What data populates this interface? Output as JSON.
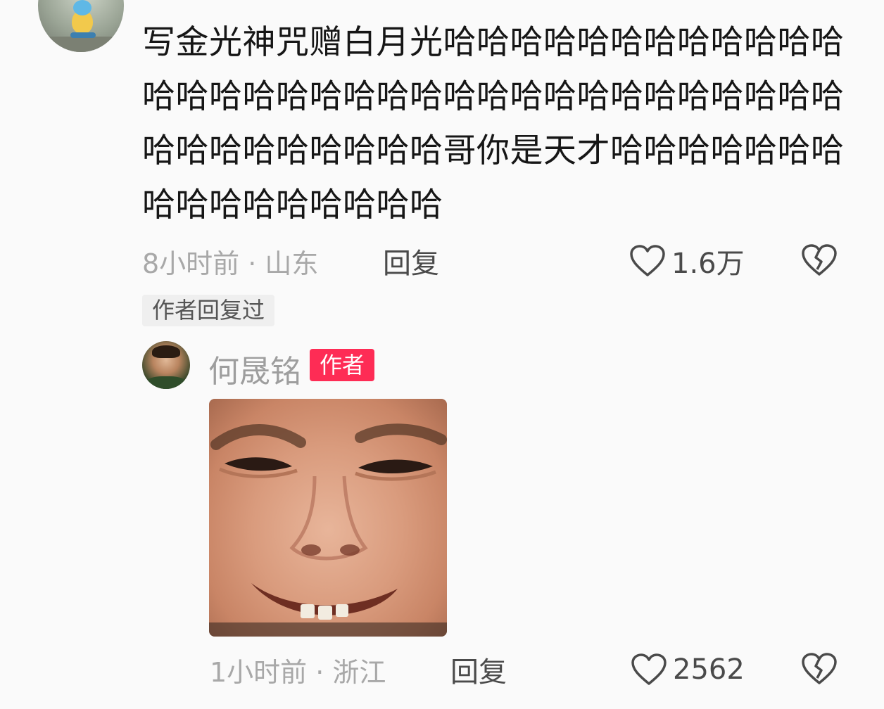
{
  "comment": {
    "text": "写金光神咒赠白月光哈哈哈哈哈哈哈哈哈哈哈哈哈哈哈哈哈哈哈哈哈哈哈哈哈哈哈哈哈哈哈哈哈哈哈哈哈哈哈哈哈哈哥你是天才哈哈哈哈哈哈哈哈哈哈哈哈哈哈哈哈",
    "time_location": "8小时前 · 山东",
    "reply_label": "回复",
    "like_count": "1.6万",
    "author_replied_tag": "作者回复过"
  },
  "reply": {
    "author_name": "何晟铭",
    "author_badge": "作者",
    "time_location": "1小时前 · 浙江",
    "reply_label": "回复",
    "like_count": "2562"
  },
  "colors": {
    "badge": "#fe2c55",
    "text": "#161616",
    "meta": "#a8a8a8"
  },
  "icons": {
    "like": "heart-outline-icon",
    "dislike": "broken-heart-icon"
  }
}
